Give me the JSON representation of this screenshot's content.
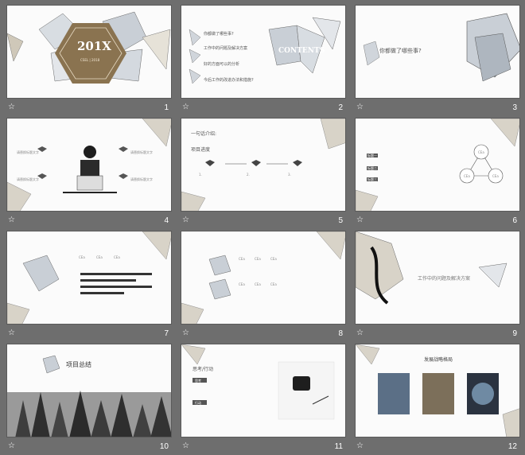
{
  "slides": [
    {
      "number": "1",
      "title": "201X",
      "subtitle": "CSEL | 2018"
    },
    {
      "number": "2",
      "title": "CONTENTS",
      "items": [
        "你都做了哪些事?",
        "工作中的问题及解决方案",
        "好的方面可以的分析",
        "今后工作的改进办法和措施?"
      ]
    },
    {
      "number": "3",
      "title": "你都做了哪些事?"
    },
    {
      "number": "4",
      "labels": [
        "请替换标题文字",
        "请替换标题文字",
        "请替换标题文字",
        "请替换标题文字"
      ]
    },
    {
      "number": "5",
      "heading1": "一句话介绍:",
      "heading2": "项目进度",
      "steps": [
        "1.",
        "2.",
        "3."
      ]
    },
    {
      "number": "6",
      "circles": [
        "CEa",
        "CEa",
        "CEa"
      ],
      "tags": [
        "标题一",
        "标题二",
        "标题三"
      ]
    },
    {
      "number": "7",
      "labels": [
        "CEa",
        "CEa",
        "CEa"
      ]
    },
    {
      "number": "8",
      "labels": [
        "CEa",
        "CEa",
        "CEa",
        "CEa",
        "CEa",
        "CEa"
      ]
    },
    {
      "number": "9",
      "title": "工作中的问题及解决方案"
    },
    {
      "number": "10",
      "title": "项目总结"
    },
    {
      "number": "11",
      "heading": "思考/行动",
      "tags": [
        "思考",
        "行动"
      ]
    },
    {
      "number": "12",
      "title": "发展战略格局"
    }
  ],
  "colors": {
    "accent": "#ff8a00",
    "frame": "#6e6e6e",
    "slide": "#fbfbfb",
    "brand": "#8a7350"
  }
}
